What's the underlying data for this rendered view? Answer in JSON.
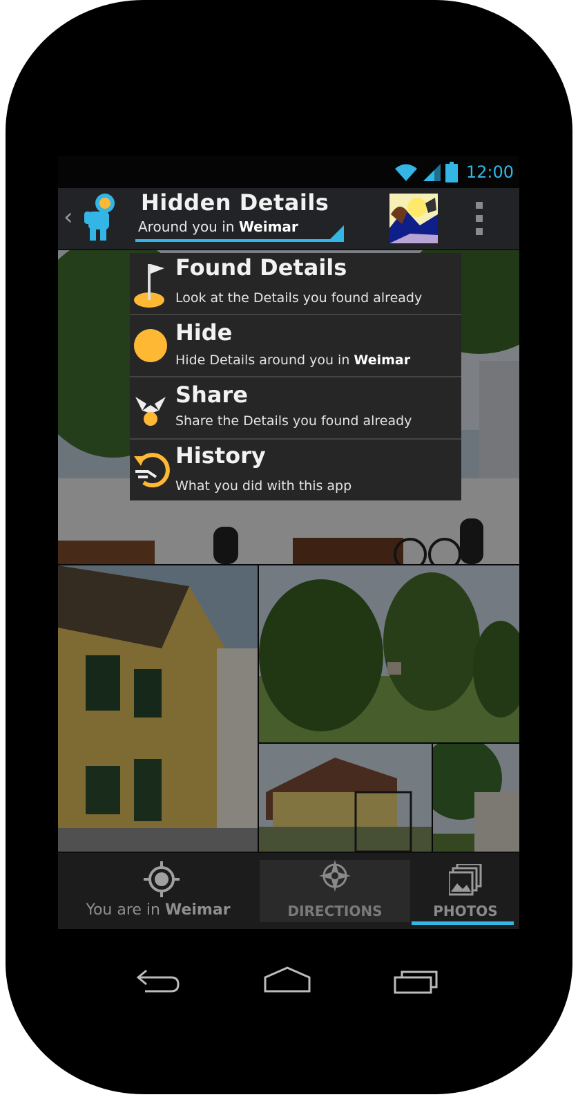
{
  "status_bar": {
    "time": "12:00"
  },
  "action_bar": {
    "title": "Hidden Details",
    "subtitle_prefix": "Around you in ",
    "city": "Weimar"
  },
  "menu": {
    "items": [
      {
        "title": "Found Details",
        "subtitle": "Look at the Details you found already",
        "subtitle_bold": "",
        "icon": "flag-pin-icon"
      },
      {
        "title": "Hide",
        "subtitle": "Hide Details around you in ",
        "subtitle_bold": "Weimar",
        "icon": "yellow-dot-icon"
      },
      {
        "title": "Share",
        "subtitle": "Share the Details you found already",
        "subtitle_bold": "",
        "icon": "share-nodes-icon"
      },
      {
        "title": "History",
        "subtitle": "What you did with this app",
        "subtitle_bold": "",
        "icon": "history-icon"
      }
    ]
  },
  "bottom_bar": {
    "location_prefix": "You are in ",
    "location_city": "Weimar",
    "directions_label": "DIRECTIONS",
    "photos_label": "PHOTOS"
  },
  "colors": {
    "accent": "#33b5e5",
    "highlight": "#ffb833"
  }
}
